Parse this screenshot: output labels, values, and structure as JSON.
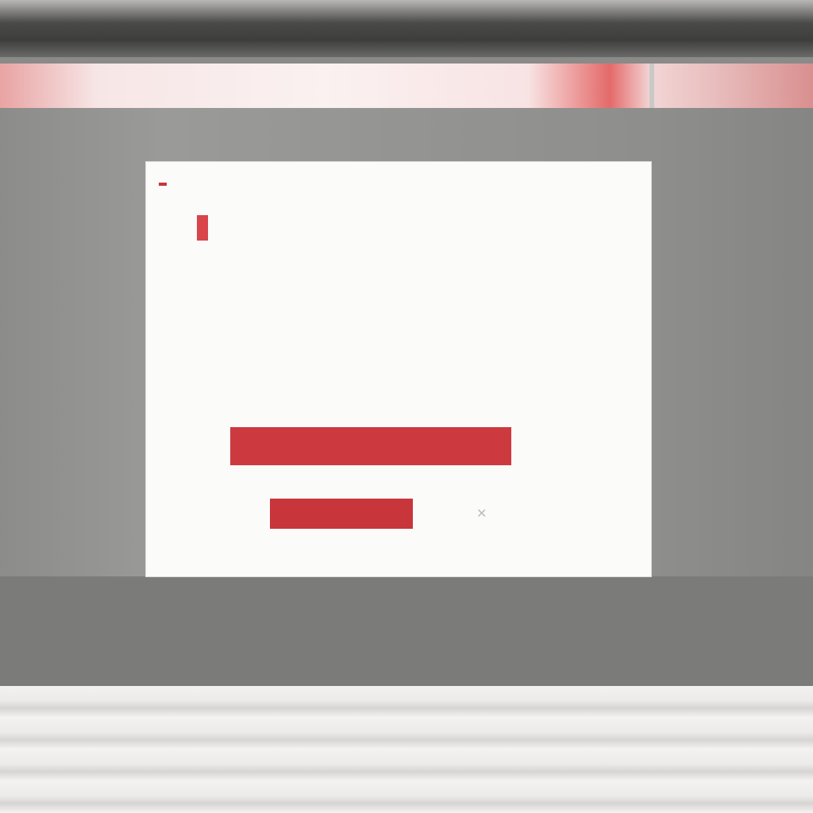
{
  "dialog": {
    "brand_logo": "",
    "brand_suffix": "",
    "title": "",
    "paragraph_1": "",
    "paragraph_2": "",
    "paragraph_3": "",
    "primary_button_label": "",
    "secondary_button_label": "",
    "footer_link": ""
  },
  "icons": {
    "close": "close-icon",
    "brand": "brand-logo"
  },
  "colors": {
    "accent": "#cc3a40",
    "dialog_background": "#fbfbfa",
    "backdrop": "#8a8a88"
  }
}
